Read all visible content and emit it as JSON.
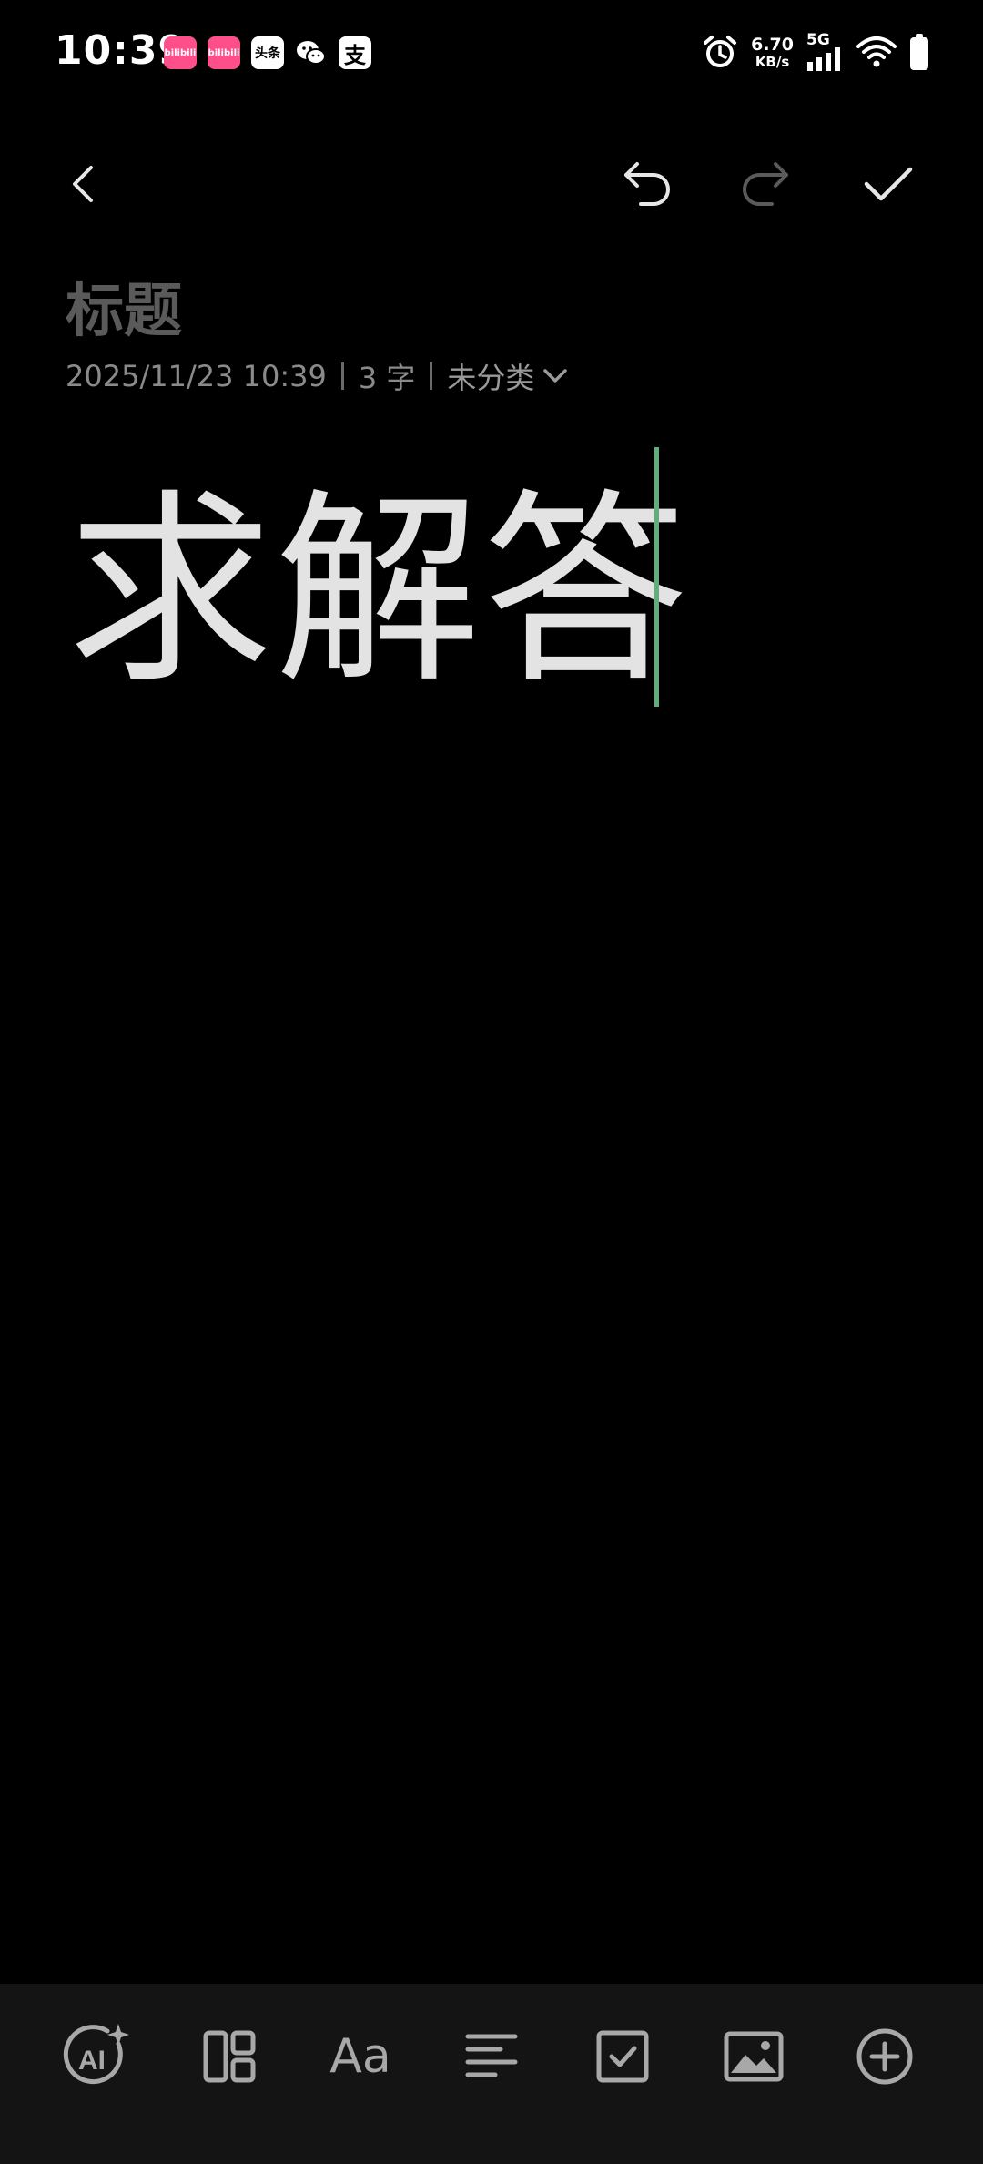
{
  "status_bar": {
    "time": "10:39",
    "notifications": [
      {
        "icon": "bilibili-icon",
        "label": "bilibili"
      },
      {
        "icon": "bilibili-icon",
        "label": "bilibili"
      },
      {
        "icon": "toutiao-icon",
        "label": "头条"
      },
      {
        "icon": "wechat-icon",
        "label": ""
      },
      {
        "icon": "alipay-icon",
        "label": "支"
      }
    ],
    "net_speed": "6.70",
    "net_unit": "KB/s",
    "net_type": "5G"
  },
  "toolbar": {
    "back": "back-icon",
    "undo": "undo-icon",
    "redo": "redo-icon",
    "done": "check-icon"
  },
  "note": {
    "title_placeholder": "标题",
    "date": "2025/11/23 10:39",
    "word_count": "3 字",
    "category": "未分类",
    "body": "求解答"
  },
  "bottom_toolbar": {
    "font_label": "Aa"
  },
  "colors": {
    "background": "#000000",
    "caret": "#5fae7c",
    "bottom_bar": "#141414"
  }
}
